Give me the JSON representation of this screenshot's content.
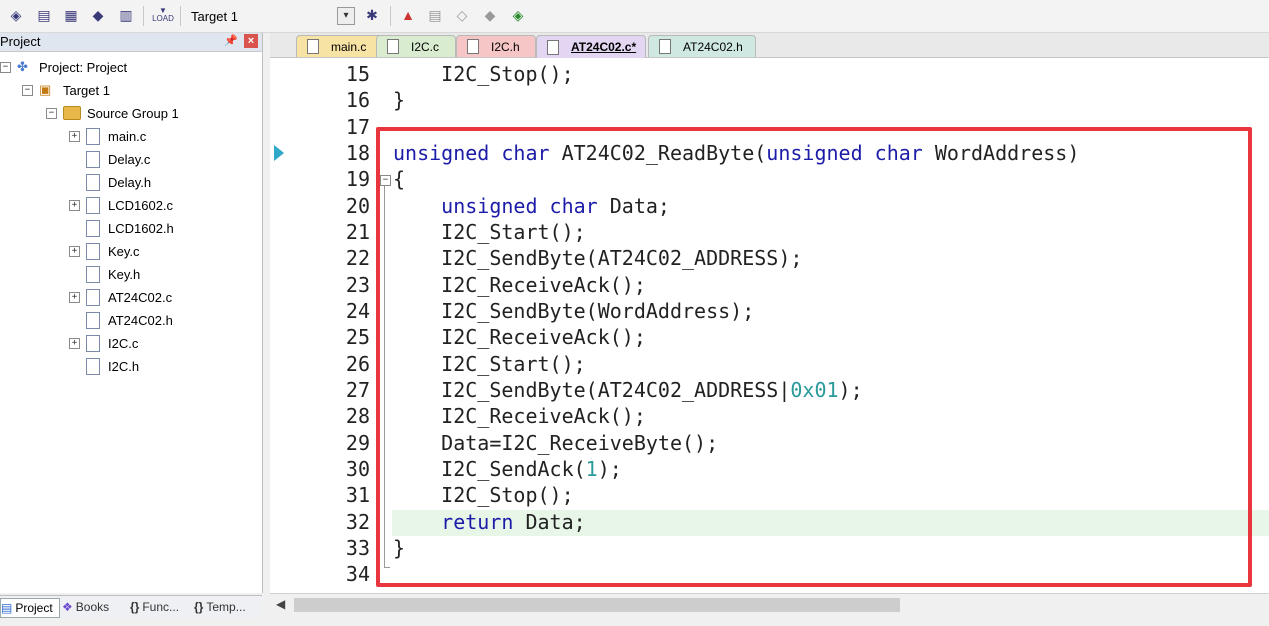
{
  "toolbar": {
    "target_label": "Target 1",
    "load_label": "LOAD"
  },
  "project": {
    "panel_title": "Project",
    "root": "Project: Project",
    "target": "Target 1",
    "group": "Source Group 1",
    "files": [
      "main.c",
      "Delay.c",
      "Delay.h",
      "LCD1602.c",
      "LCD1602.h",
      "Key.c",
      "Key.h",
      "AT24C02.c",
      "AT24C02.h",
      "I2C.c",
      "I2C.h"
    ]
  },
  "bottom_tabs": [
    "Project",
    "Books",
    "Func...",
    "Temp..."
  ],
  "file_tabs": [
    {
      "label": "main.c",
      "color": "#f7e3a3"
    },
    {
      "label": "I2C.c",
      "color": "#d9ecd0"
    },
    {
      "label": "I2C.h",
      "color": "#f6c6c6"
    },
    {
      "label": "AT24C02.c*",
      "color": "#e2d6f3"
    },
    {
      "label": "AT24C02.h",
      "color": "#cfe8e2"
    }
  ],
  "code": {
    "lines": [
      {
        "n": "15",
        "text": "    I2C_Stop();"
      },
      {
        "n": "16",
        "text": "}"
      },
      {
        "n": "17",
        "text": ""
      },
      {
        "n": "18",
        "kw1": "unsigned char",
        "mid": " AT24C02_ReadByte(",
        "kw2": "unsigned char",
        "tail": " WordAddress)"
      },
      {
        "n": "19",
        "text": "{"
      },
      {
        "n": "20",
        "kw1": "    unsigned char",
        "tail": " Data;"
      },
      {
        "n": "21",
        "text": "    I2C_Start();"
      },
      {
        "n": "22",
        "text": "    I2C_SendByte(AT24C02_ADDRESS);"
      },
      {
        "n": "23",
        "text": "    I2C_ReceiveAck();"
      },
      {
        "n": "24",
        "text": "    I2C_SendByte(WordAddress);"
      },
      {
        "n": "25",
        "text": "    I2C_ReceiveAck();"
      },
      {
        "n": "26",
        "text": "    I2C_Start();"
      },
      {
        "n": "27",
        "pre": "    I2C_SendByte(AT24C02_ADDRESS|",
        "num": "0x01",
        "post": ");"
      },
      {
        "n": "28",
        "text": "    I2C_ReceiveAck();"
      },
      {
        "n": "29",
        "text": "    Data=I2C_ReceiveByte();"
      },
      {
        "n": "30",
        "pre": "    I2C_SendAck(",
        "num": "1",
        "post": ");"
      },
      {
        "n": "31",
        "text": "    I2C_Stop();"
      },
      {
        "n": "32",
        "kw1": "    return",
        "tail": " Data;"
      },
      {
        "n": "33",
        "text": "}"
      },
      {
        "n": "34",
        "text": ""
      }
    ]
  },
  "colors": {
    "keyword": "#1c1ca8",
    "number": "#2a9a9a",
    "annotation_box": "#e8353e",
    "current_line": "#e8f6e8"
  }
}
